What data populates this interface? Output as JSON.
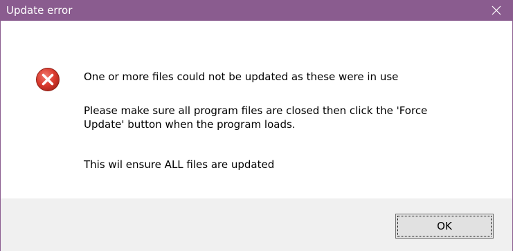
{
  "window": {
    "title": "Update error",
    "titlebar_color": "#8a5c8f",
    "close_icon": "close-icon"
  },
  "message": {
    "icon": "error-icon",
    "icon_color": "#c42b1c",
    "line1": "One or more files could not be updated as these were in use",
    "line2a": "Please make sure all program files are closed then click the 'Force",
    "line2b": "Update' button when the program loads.",
    "line3": "This wil ensure ALL files are updated"
  },
  "buttons": {
    "ok_label": "OK"
  }
}
